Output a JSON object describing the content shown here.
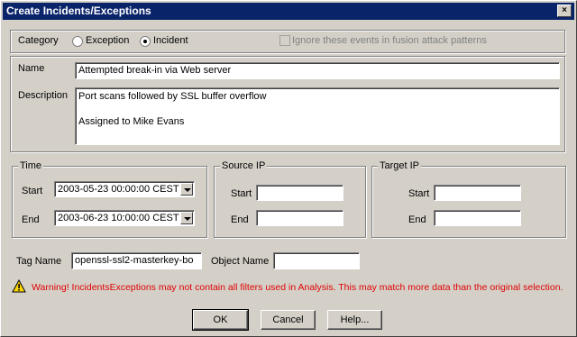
{
  "window": {
    "title": "Create Incidents/Exceptions",
    "close_glyph": "×"
  },
  "category": {
    "label": "Category",
    "options": [
      {
        "label": "Exception",
        "selected": false
      },
      {
        "label": "Incident",
        "selected": true
      }
    ],
    "ignore_checkbox": {
      "label": "Ignore these events in fusion attack patterns",
      "checked": false,
      "enabled": false
    }
  },
  "details": {
    "name_label": "Name",
    "name_value": "Attempted break-in via Web server",
    "description_label": "Description",
    "description_lines": [
      "Port scans followed by SSL buffer overflow",
      "",
      "Assigned to Mike Evans"
    ]
  },
  "time": {
    "legend": "Time",
    "start_label": "Start",
    "start_value": "2003-05-23 00:00:00 CEST",
    "end_label": "End",
    "end_value": "2003-06-23 10:00:00 CEST"
  },
  "source_ip": {
    "legend": "Source IP",
    "start_label": "Start",
    "start_value": "",
    "end_label": "End",
    "end_value": ""
  },
  "target_ip": {
    "legend": "Target IP",
    "start_label": "Start",
    "start_value": "",
    "end_label": "End",
    "end_value": ""
  },
  "tags": {
    "tag_name_label": "Tag Name",
    "tag_name_value": "openssl-ssl2-masterkey-bo",
    "object_name_label": "Object Name",
    "object_name_value": ""
  },
  "warning": {
    "icon": "warning-icon",
    "text": "Warning! IncidentsExceptions may not contain all filters used in Analysis.  This may match more data than the original selection.",
    "color": "#e00000"
  },
  "buttons": {
    "ok": "OK",
    "cancel": "Cancel",
    "help": "Help..."
  }
}
